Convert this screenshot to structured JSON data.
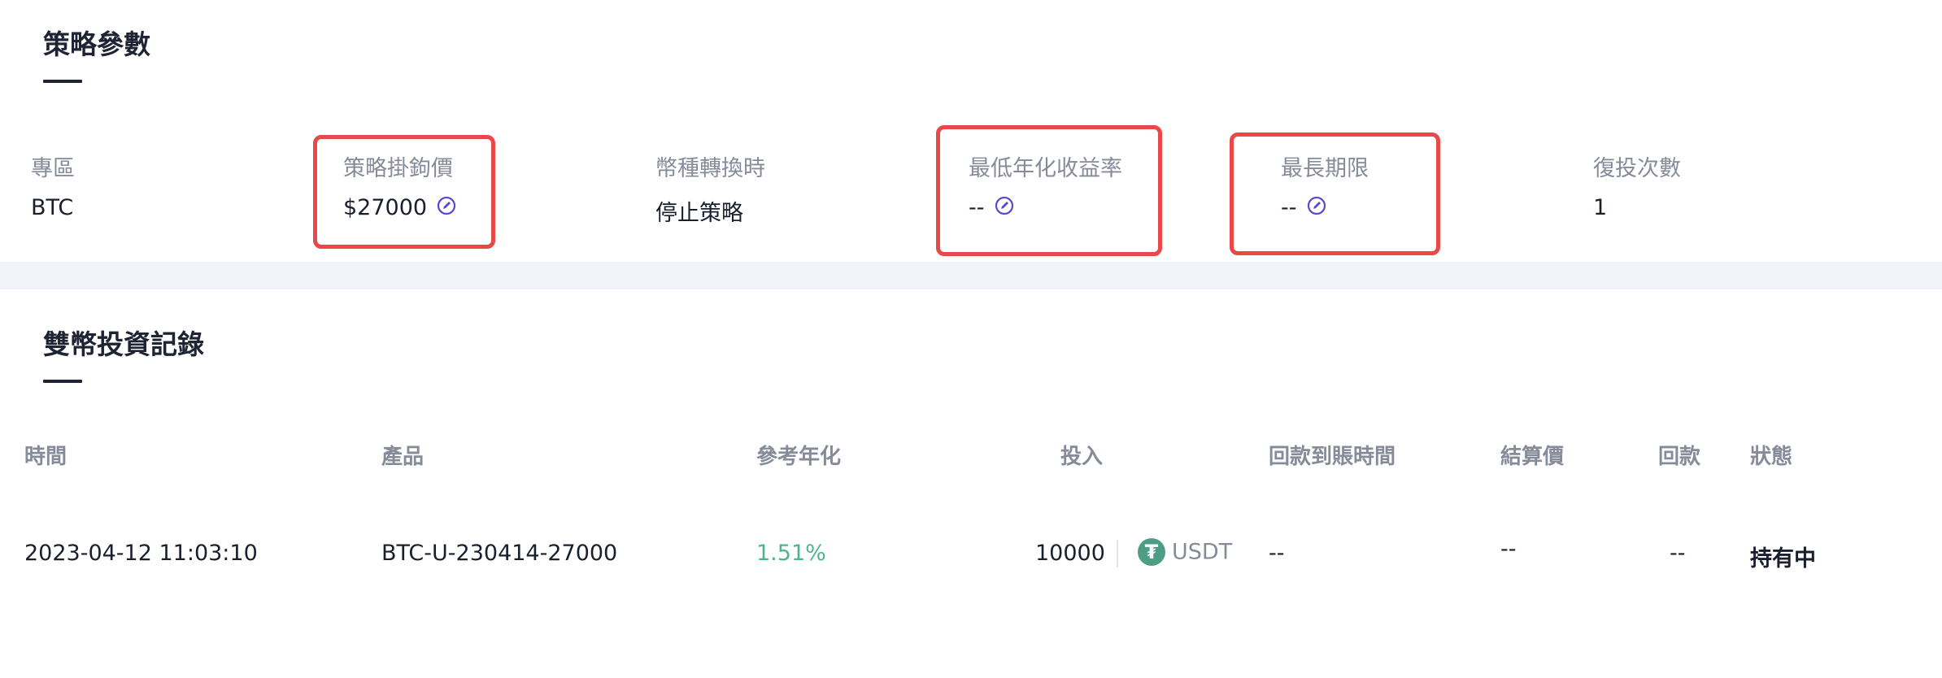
{
  "strategy_params": {
    "title": "策略參數",
    "items": [
      {
        "label": "專區",
        "value": "BTC"
      },
      {
        "label": "策略掛鉤價",
        "value": "$27000"
      },
      {
        "label": "幣種轉換時",
        "value": "停止策略"
      },
      {
        "label": "最低年化收益率",
        "value": "--"
      },
      {
        "label": "最長期限",
        "value": "--"
      },
      {
        "label": "復投次數",
        "value": "1"
      }
    ]
  },
  "records": {
    "title": "雙幣投資記錄",
    "columns": [
      "時間",
      "產品",
      "參考年化",
      "投入",
      "回款到賬時間",
      "結算價",
      "回款",
      "狀態"
    ],
    "rows": [
      {
        "time": "2023-04-12 11:03:10",
        "product": "BTC-U-230414-27000",
        "annualized": "1.51%",
        "invest_amount": "10000",
        "invest_currency": "USDT",
        "payout_time": "--",
        "settlement_price": "--",
        "payout": "--",
        "status": "持有中"
      }
    ]
  },
  "icons": {
    "edit": "edit-pencil-icon",
    "coin": "tether-icon"
  },
  "colors": {
    "highlight_box": "#e84848",
    "edit_icon": "#5b47d6",
    "positive_rate": "#4fb58c",
    "tether": "#4f9d84"
  }
}
